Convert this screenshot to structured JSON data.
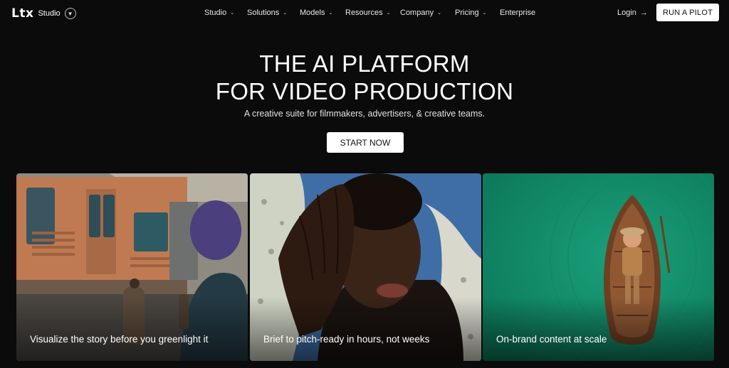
{
  "nav": {
    "logo_mark": "Ltx",
    "logo_studio": "Studio",
    "items": [
      {
        "label": "Studio"
      },
      {
        "label": "Solutions"
      },
      {
        "label": "Models"
      },
      {
        "label": "Resources"
      },
      {
        "label": "Company"
      },
      {
        "label": "Pricing"
      },
      {
        "label": "Enterprise"
      }
    ],
    "login": "Login",
    "pilot": "RUN A PILOT"
  },
  "hero": {
    "title_line1": "THE AI PLATFORM",
    "title_line2": "FOR VIDEO PRODUCTION",
    "subtitle": "A creative suite for filmmakers, advertisers, & creative teams.",
    "cta": "START NOW"
  },
  "cards": [
    {
      "caption": "Visualize the story before you greenlight it"
    },
    {
      "caption": "Brief to pitch-ready in hours, not weeks"
    },
    {
      "caption": "On-brand content at scale"
    }
  ],
  "colors": {
    "background": "#0b0b0b",
    "button": "#ffffff",
    "card3_bg": "#13936e"
  }
}
